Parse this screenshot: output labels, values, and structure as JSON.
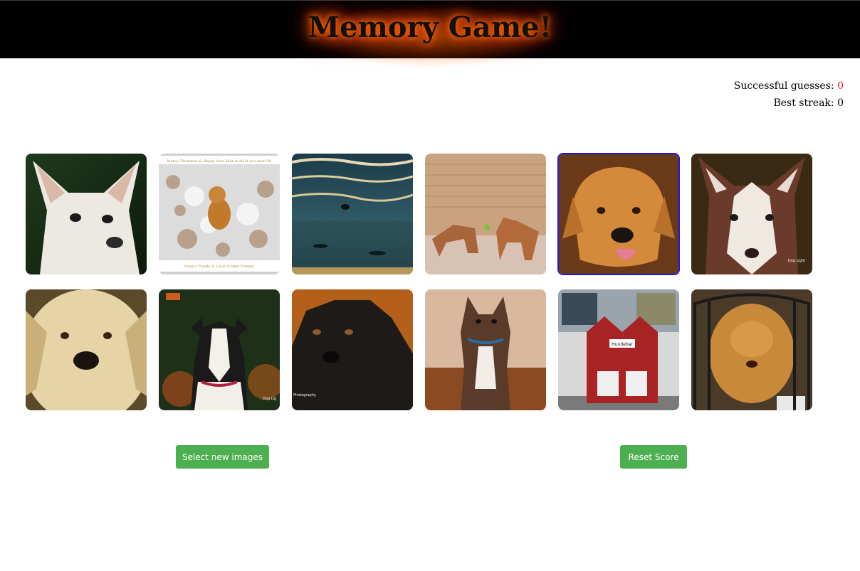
{
  "header": {
    "title": "Memory Game!"
  },
  "score": {
    "successful_label": "Successful guesses:",
    "successful_value": "0",
    "best_label": "Best streak:",
    "best_value": "0"
  },
  "cards": [
    {
      "subject": "chihuahua"
    },
    {
      "subject": "golden retriever in snow"
    },
    {
      "subject": "dog at beach"
    },
    {
      "subject": "two dogs playing"
    },
    {
      "subject": "smiling hound",
      "selected": true
    },
    {
      "subject": "husky"
    },
    {
      "subject": "great pyrenees"
    },
    {
      "subject": "tricolor dog"
    },
    {
      "subject": "black dog"
    },
    {
      "subject": "brindle bulldog"
    },
    {
      "subject": "red dog house"
    },
    {
      "subject": "golden dog in crate"
    }
  ],
  "card_texts": {
    "snow_top": "Merry Christmas & Happy New Year to all of you dear Fri",
    "snow_bottom": "Vanni's Family & Loyal Golden Friends",
    "husky_sig": "Dog Light",
    "tricolor_sig": "Dog Lig",
    "black_sig": "Photography",
    "sign": "Hundebar"
  },
  "buttons": {
    "new_images": "Select new images",
    "reset": "Reset Score"
  },
  "colors": {
    "header_bg": "#000000",
    "glow": "#ff6a00",
    "button": "#4caf50",
    "selected_border": "#1a1ae0",
    "score_value": "#e02020"
  }
}
